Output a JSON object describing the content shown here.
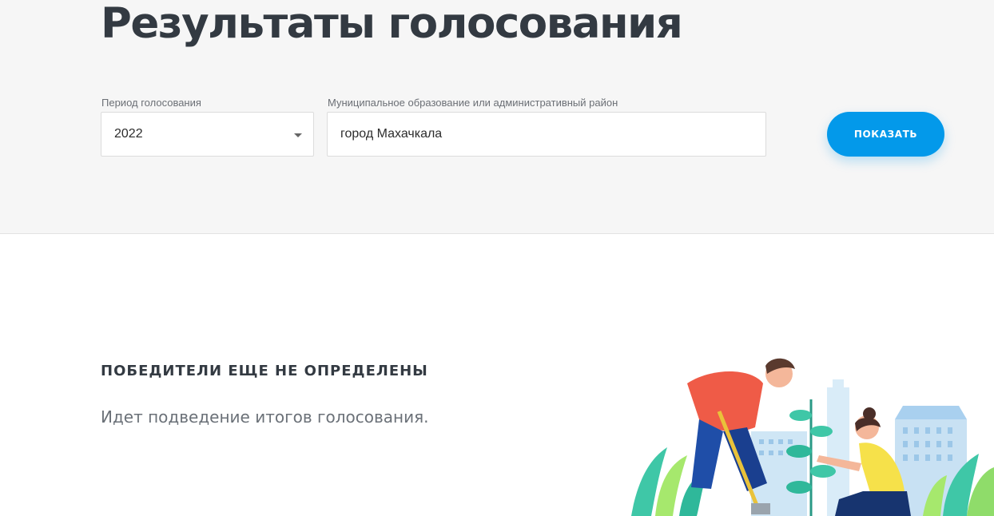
{
  "header": {
    "title": "Результаты голосования"
  },
  "filters": {
    "period_label": "Период голосования",
    "period_value": "2022",
    "municipality_label": "Муниципальное образование или административный район",
    "municipality_value": "город Махачкала",
    "show_button_label": "ПОКАЗАТЬ"
  },
  "results": {
    "heading": "ПОБЕДИТЕЛИ ЕЩЕ НЕ ОПРЕДЕЛЕНЫ",
    "message": "Идет подведение итогов голосования."
  },
  "colors": {
    "accent": "#0399ea",
    "title": "#333a42",
    "top_background": "#f6f6f6"
  },
  "icons": {
    "select_caret": "caret-down-icon",
    "illustration": "gardening-people-illustration"
  }
}
